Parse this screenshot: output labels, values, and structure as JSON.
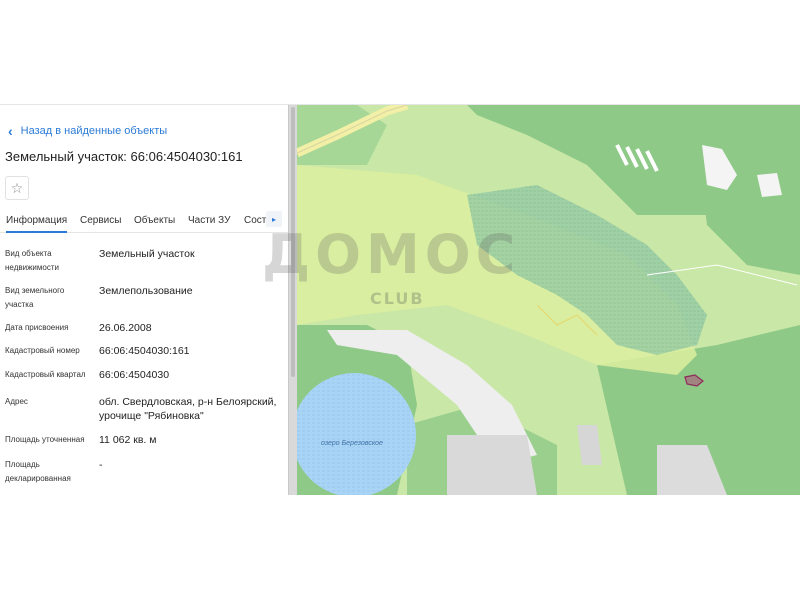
{
  "panel": {
    "back_label": "Назад в найденные объекты",
    "title": "Земельный участок: 66:06:4504030:161",
    "fav_icon": "☆",
    "tabs": [
      "Информация",
      "Сервисы",
      "Объекты",
      "Части ЗУ",
      "Соста"
    ],
    "active_tab": "Информация",
    "tabs_more_icon": "▸",
    "properties": [
      {
        "label": "Вид объекта недвижимости",
        "value": "Земельный участок"
      },
      {
        "label": "Вид земельного участка",
        "value": "Землепользование"
      },
      {
        "label": "Дата присвоения",
        "value": "26.06.2008"
      },
      {
        "label": "Кадастровый номер",
        "value": "66:06:4504030:161"
      },
      {
        "label": "Кадастровый квартал",
        "value": "66:06:4504030"
      },
      {
        "label": "Адрес",
        "value": "обл. Свердловская, р-н Белоярский, урочище \"Рябиновка\""
      },
      {
        "label": "Площадь уточненная",
        "value": "11 062 кв. м"
      },
      {
        "label": "Площадь декларированная",
        "value": "-"
      }
    ]
  },
  "map": {
    "lake_label": "озеро Березовское",
    "parcel_color": "#8e2a5a"
  },
  "watermark": {
    "main": "ДОМОС",
    "sub": "CLUB"
  }
}
